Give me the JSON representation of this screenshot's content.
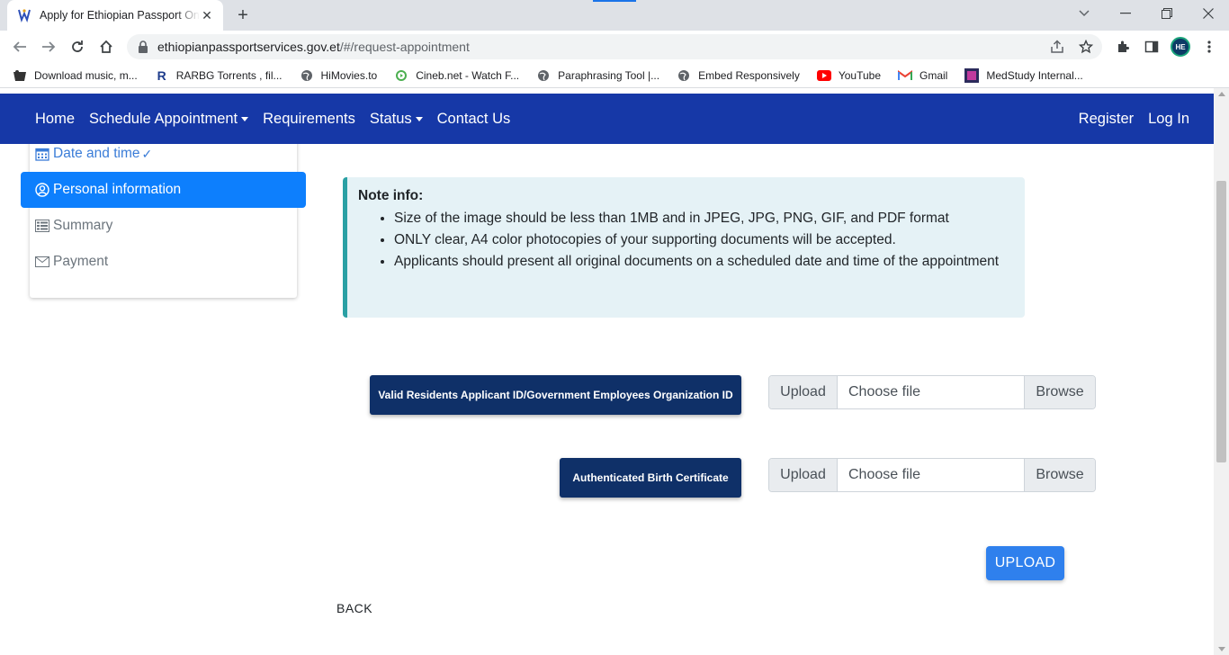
{
  "browser": {
    "tab_title": "Apply for Ethiopian Passport Online",
    "url_host": "ethiopianpassportservices.gov.et",
    "url_path": "/#/request-appointment",
    "profile_initials": "HE",
    "bookmarks": [
      {
        "label": "Download music, m...",
        "icon": "music-icon"
      },
      {
        "label": "RARBG Torrents , fil...",
        "icon": "rarbg-icon"
      },
      {
        "label": "HiMovies.to",
        "icon": "globe-icon"
      },
      {
        "label": "Cineb.net - Watch F...",
        "icon": "play-icon"
      },
      {
        "label": "Paraphrasing Tool |...",
        "icon": "globe-icon"
      },
      {
        "label": "Embed Responsively",
        "icon": "globe-icon"
      },
      {
        "label": "YouTube",
        "icon": "youtube-icon"
      },
      {
        "label": "Gmail",
        "icon": "gmail-icon"
      },
      {
        "label": "MedStudy Internal...",
        "icon": "medstudy-icon"
      }
    ]
  },
  "nav": {
    "home": "Home",
    "schedule": "Schedule Appointment",
    "requirements": "Requirements",
    "status": "Status",
    "contact": "Contact Us",
    "register": "Register",
    "login": "Log In"
  },
  "steps": {
    "date_time": "Date and time",
    "personal_info": "Personal information",
    "summary": "Summary",
    "payment": "Payment"
  },
  "note": {
    "title": "Note info:",
    "items": [
      "Size of the image should be less than 1MB and in JPEG, JPG, PNG, GIF, and PDF format",
      "ONLY clear, A4 color photocopies of your supporting documents will be accepted.",
      "Applicants should present all original documents on a scheduled date and time of the appointment"
    ]
  },
  "documents": [
    {
      "label": "Valid Residents Applicant ID/Government Employees Organization ID",
      "prepend": "Upload",
      "placeholder": "Choose file",
      "browse": "Browse"
    },
    {
      "label": "Authenticated Birth Certificate",
      "prepend": "Upload",
      "placeholder": "Choose file",
      "browse": "Browse"
    }
  ],
  "actions": {
    "upload": "UPLOAD",
    "back": "BACK"
  },
  "colors": {
    "navbar": "#1638a7",
    "active_step": "#0d7ffd",
    "doc_label": "#0f3068",
    "note_bg": "#e5f2f6",
    "note_border": "#2aa0a4",
    "upload_button": "#2f80ed"
  }
}
